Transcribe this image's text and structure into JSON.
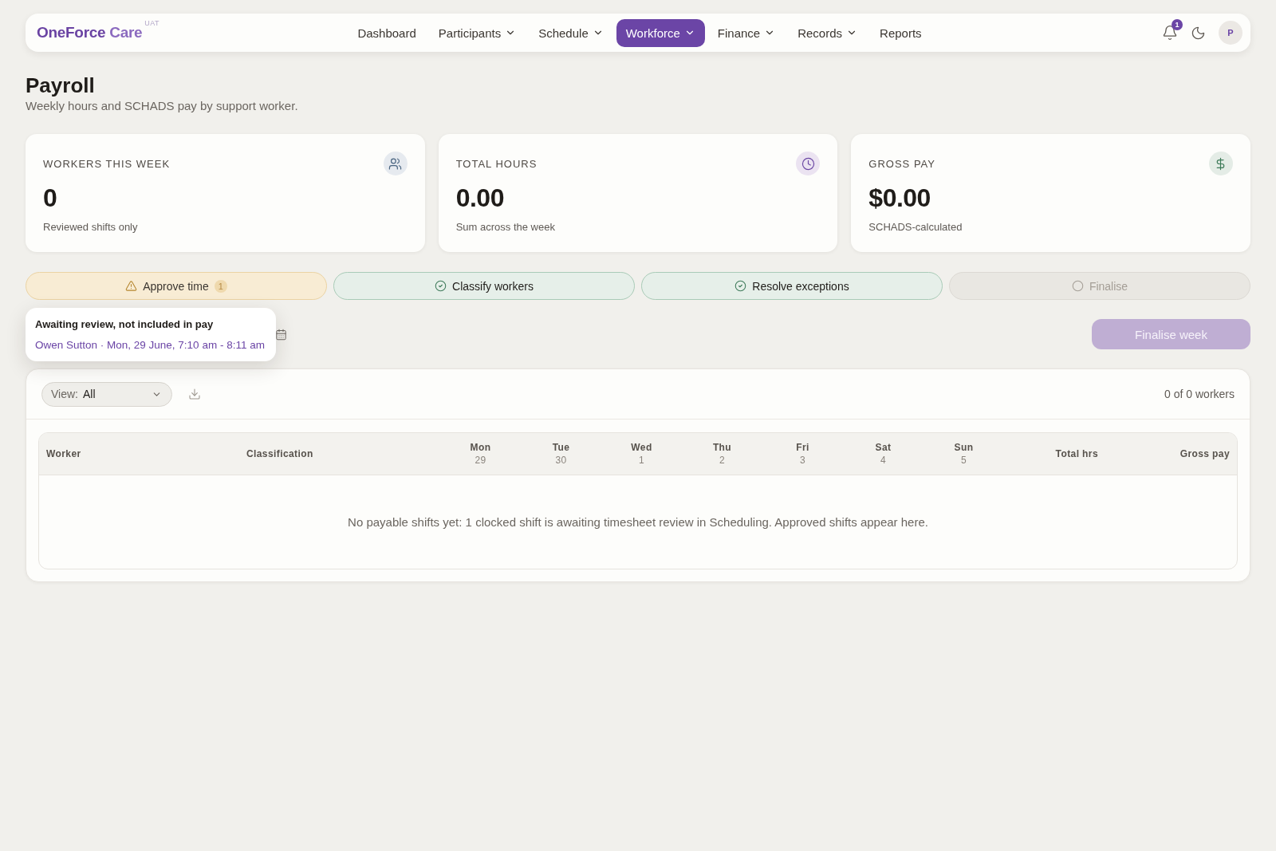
{
  "header": {
    "brand": {
      "primary": "OneForce",
      "secondary": "Care",
      "environment": "UAT"
    },
    "nav": [
      {
        "label": "Dashboard",
        "selected": false,
        "dropdown": false
      },
      {
        "label": "Participants",
        "selected": false,
        "dropdown": true
      },
      {
        "label": "Schedule",
        "selected": false,
        "dropdown": true
      },
      {
        "label": "Workforce",
        "selected": true,
        "dropdown": true
      },
      {
        "label": "Finance",
        "selected": false,
        "dropdown": true
      },
      {
        "label": "Records",
        "selected": false,
        "dropdown": true
      },
      {
        "label": "Reports",
        "selected": false,
        "dropdown": false
      }
    ],
    "notifications": {
      "count": "1"
    },
    "avatar": {
      "initial": "P"
    }
  },
  "page": {
    "title": "Payroll",
    "subtitle": "Weekly hours and SCHADS pay by support worker."
  },
  "stats": [
    {
      "kind": "count",
      "label": "WORKERS THIS WEEK",
      "value": "0",
      "caption": "Reviewed shifts only"
    },
    {
      "kind": "duration",
      "label": "TOTAL HOURS",
      "value": "0.00",
      "caption": "Sum across the week"
    },
    {
      "kind": "currency",
      "label": "GROSS PAY",
      "value": "$0.00",
      "caption": "SCHADS-calculated"
    }
  ],
  "steps": [
    {
      "label": "Approve time",
      "complete": false,
      "warning": true,
      "count": "1"
    },
    {
      "label": "Classify workers",
      "complete": true,
      "warning": false
    },
    {
      "label": "Resolve exceptions",
      "complete": true,
      "warning": false
    },
    {
      "label": "Finalise",
      "complete": false,
      "warning": false
    }
  ],
  "tooltip": {
    "title": "Awaiting review, not included in pay",
    "link": "Owen Sutton · Mon, 29 June, 7:10 am - 8:11 am"
  },
  "finalise_button": {
    "label": "Finalise week",
    "disabled": true
  },
  "table": {
    "view": {
      "label": "View:",
      "value": "All"
    },
    "count": "0 of 0 workers",
    "columns": [
      {
        "label": "Worker",
        "kind": "text"
      },
      {
        "label": "Classification",
        "kind": "text"
      },
      {
        "label": "Mon",
        "sub": "29",
        "kind": "day"
      },
      {
        "label": "Tue",
        "sub": "30",
        "kind": "day"
      },
      {
        "label": "Wed",
        "sub": "1",
        "kind": "day"
      },
      {
        "label": "Thu",
        "sub": "2",
        "kind": "day"
      },
      {
        "label": "Fri",
        "sub": "3",
        "kind": "day"
      },
      {
        "label": "Sat",
        "sub": "4",
        "kind": "day"
      },
      {
        "label": "Sun",
        "sub": "5",
        "kind": "day"
      },
      {
        "label": "Total hrs",
        "kind": "number"
      },
      {
        "label": "Gross pay",
        "kind": "number"
      }
    ],
    "empty_message": "No payable shifts yet: 1 clocked shift is awaiting timesheet review in Scheduling. Approved shifts appear here."
  }
}
